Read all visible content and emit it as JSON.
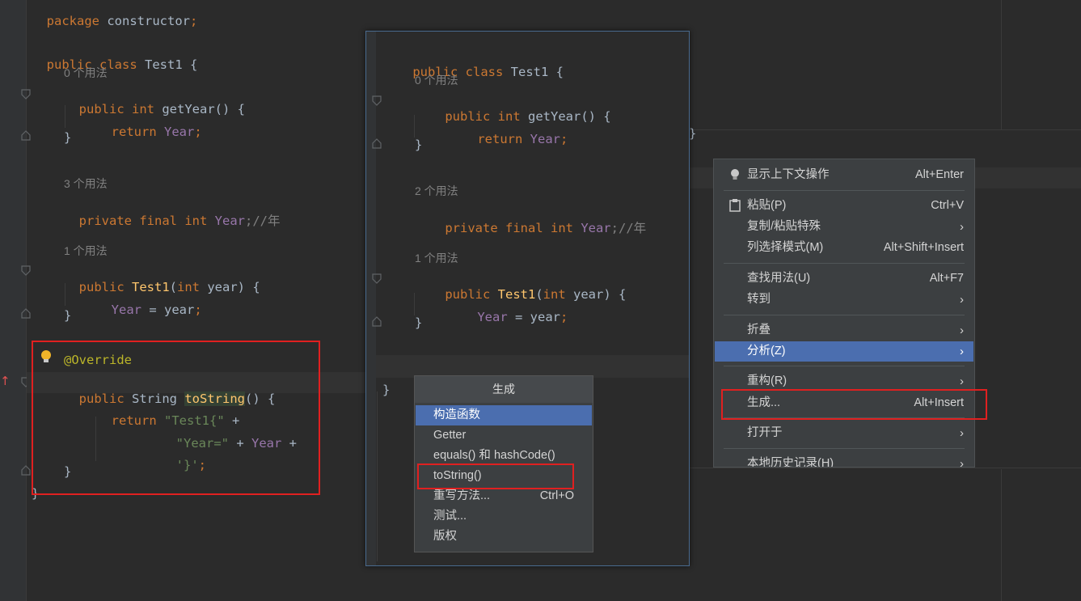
{
  "editor_main": {
    "line_package": [
      "package",
      " constructor",
      ";"
    ],
    "class_decl": [
      "public",
      " class",
      " Test1 {"
    ],
    "usage_0": "0 个用法",
    "getYear": [
      "public",
      " int",
      " getYear",
      "() {"
    ],
    "return_year": [
      "return",
      " Year",
      ";"
    ],
    "close_brace": "}",
    "usage_3": "3 个用法",
    "field": [
      "private",
      " final",
      " int",
      " Year",
      ";//年"
    ],
    "usage_1": "1 个用法",
    "ctor": [
      "public",
      " Test1",
      "(",
      "int",
      " year) {"
    ],
    "assign": [
      "Year",
      " = year",
      ";"
    ],
    "override": "@Override",
    "tostring_decl": [
      "public",
      " String ",
      "toString",
      "() {"
    ],
    "ret_str": [
      "return",
      " \"Test1{\"",
      " +"
    ],
    "year_str": [
      "\"Year=\"",
      " + ",
      "Year",
      " +"
    ],
    "brace_str": [
      "'}'",
      ";"
    ],
    "class_close": "}"
  },
  "popup_editor": {
    "class_decl": [
      "public",
      " class",
      " Test1 {"
    ],
    "usage_0": "0 个用法",
    "getYear": [
      "public",
      " int",
      " getYear",
      "() {"
    ],
    "return_year": [
      "return",
      " Year",
      ";"
    ],
    "close_brace": "}",
    "usage_2": "2 个用法",
    "field": [
      "private",
      " final",
      " int",
      " Year",
      ";//年"
    ],
    "usage_1": "1 个用法",
    "ctor": [
      "public",
      " Test1",
      "(",
      "int",
      " year) {"
    ],
    "assign": [
      "Year",
      " = year",
      ";"
    ],
    "class_close": "}"
  },
  "generate_menu": {
    "title": "生成",
    "items": [
      {
        "label": "构造函数",
        "shortcut": "",
        "selected": true
      },
      {
        "label": "Getter",
        "shortcut": ""
      },
      {
        "label": "equals() 和 hashCode()",
        "shortcut": ""
      },
      {
        "label": "toString()",
        "shortcut": ""
      },
      {
        "label": "重写方法...",
        "shortcut": "Ctrl+O"
      },
      {
        "label": "测试...",
        "shortcut": ""
      },
      {
        "label": "版权",
        "shortcut": ""
      }
    ]
  },
  "context_menu": {
    "items": [
      {
        "label": "显示上下文操作",
        "shortcut": "Alt+Enter",
        "icon": "bulb-icon"
      },
      {
        "label": "粘贴(P)",
        "shortcut": "Ctrl+V",
        "icon": "clipboard-icon"
      },
      {
        "label": "复制/粘贴特殊",
        "shortcut": "",
        "submenu": "›"
      },
      {
        "label": "列选择模式(M)",
        "shortcut": "Alt+Shift+Insert"
      },
      {
        "label": "查找用法(U)",
        "shortcut": "Alt+F7"
      },
      {
        "label": "转到",
        "submenu": "›"
      },
      {
        "label": "折叠",
        "submenu": "›"
      },
      {
        "label": "分析(Z)",
        "submenu": "›",
        "selected": true
      },
      {
        "label": "重构(R)",
        "submenu": "›"
      },
      {
        "label": "生成...",
        "shortcut": "Alt+Insert"
      },
      {
        "label": "打开于",
        "submenu": "›"
      },
      {
        "label": "本地历史记录(H)",
        "submenu": "›"
      }
    ]
  },
  "colors": {
    "background": "#2b2b2b",
    "keyword": "#cc7832",
    "field": "#9876aa",
    "method": "#ffc66d",
    "string": "#6a8759",
    "annotation": "#bbb529",
    "highlight_box": "#e02020",
    "selection": "#4b6eaf"
  }
}
